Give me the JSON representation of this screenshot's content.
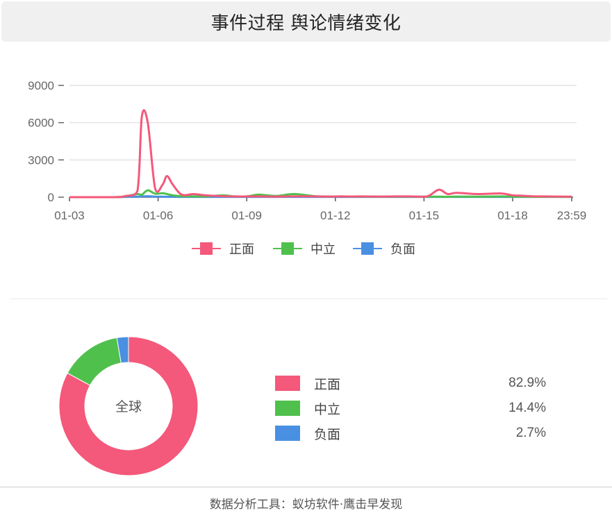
{
  "header": {
    "title": "事件过程 舆论情绪变化"
  },
  "colors": {
    "positive": "#f4587a",
    "neutral": "#4fc04c",
    "negative": "#4a90e2"
  },
  "chart_data": [
    {
      "type": "line",
      "title": "",
      "xlabel": "",
      "ylabel": "",
      "ylim": [
        0,
        9000
      ],
      "yticks": [
        0,
        3000,
        6000,
        9000
      ],
      "xticks": [
        "01-03",
        "01-06",
        "01-09",
        "01-12",
        "01-15",
        "01-18",
        "23:59"
      ],
      "grid": true,
      "legend_position": "bottom",
      "x": [
        0,
        1.5,
        1.9,
        2.3,
        2.45,
        2.65,
        2.9,
        3.15,
        3.3,
        3.5,
        3.8,
        4.2,
        4.6,
        5.2,
        5.6,
        6.0,
        6.4,
        7.0,
        7.6,
        8.4,
        8.9,
        9.2,
        9.6,
        9.8,
        10.5,
        11.0,
        11.5,
        12.1,
        12.5,
        12.8,
        13.1,
        13.8,
        14.6,
        15.0,
        15.3,
        15.6,
        16.0,
        17.0
      ],
      "series": [
        {
          "name": "正面",
          "values": [
            0,
            0,
            100,
            500,
            6500,
            6000,
            700,
            1000,
            1700,
            1000,
            200,
            250,
            150,
            80,
            60,
            60,
            60,
            50,
            70,
            60,
            50,
            60,
            50,
            60,
            50,
            60,
            60,
            60,
            600,
            250,
            350,
            250,
            300,
            150,
            120,
            80,
            60,
            40
          ]
        },
        {
          "name": "中立",
          "values": [
            0,
            0,
            80,
            250,
            200,
            550,
            280,
            320,
            250,
            150,
            80,
            70,
            60,
            150,
            60,
            60,
            200,
            100,
            250,
            60,
            50,
            60,
            40,
            50,
            40,
            40,
            40,
            40,
            40,
            30,
            50,
            40,
            60,
            40,
            40,
            30,
            30,
            20
          ]
        },
        {
          "name": "负面",
          "values": [
            0,
            0,
            20,
            40,
            60,
            80,
            40,
            40,
            30,
            30,
            20,
            20,
            20,
            20,
            20,
            20,
            20,
            20,
            20,
            20,
            20,
            20,
            20,
            20,
            20,
            20,
            20,
            20,
            20,
            20,
            20,
            20,
            20,
            20,
            20,
            20,
            20,
            20
          ]
        }
      ]
    },
    {
      "type": "pie",
      "center_label": "全球",
      "labels": [
        "正面",
        "中立",
        "负面"
      ],
      "values": [
        82.9,
        14.4,
        2.7
      ],
      "value_labels": [
        "82.9%",
        "14.4%",
        "2.7%"
      ]
    }
  ],
  "footer": {
    "text": "数据分析工具：蚁坊软件·鹰击早发现"
  }
}
